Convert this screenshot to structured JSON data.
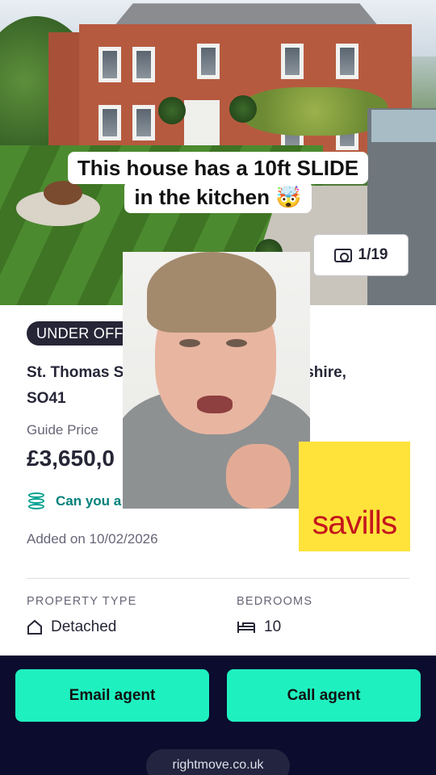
{
  "caption": {
    "line1": "This house has a 10ft SLIDE",
    "line2": "in the kitchen 🤯"
  },
  "gallery": {
    "photo_counter": "1/19",
    "camera_icon": "camera-icon"
  },
  "listing": {
    "status_badge": "UNDER OFFER",
    "address_line1": "St. Thomas Stre                          , Hampshire,",
    "address_line2": "SO41",
    "guide_price_label": "Guide Price",
    "price": "£3,650,0",
    "affordability_link": "Can you a",
    "added_date": "Added on 10/02/2026"
  },
  "key_features": [
    {
      "label": "PROPERTY TYPE",
      "value": "Detached",
      "icon": "house-icon"
    },
    {
      "label": "BEDROOMS",
      "value": "10",
      "icon": "bed-icon"
    }
  ],
  "agent": {
    "logo_text": "savills",
    "logo_bg": "#ffe33b",
    "logo_color": "#c4161c"
  },
  "actions": {
    "email_label": "Email agent",
    "call_label": "Call agent",
    "accent": "#1ff0c0"
  },
  "footer": {
    "site": "rightmove.co.uk"
  }
}
